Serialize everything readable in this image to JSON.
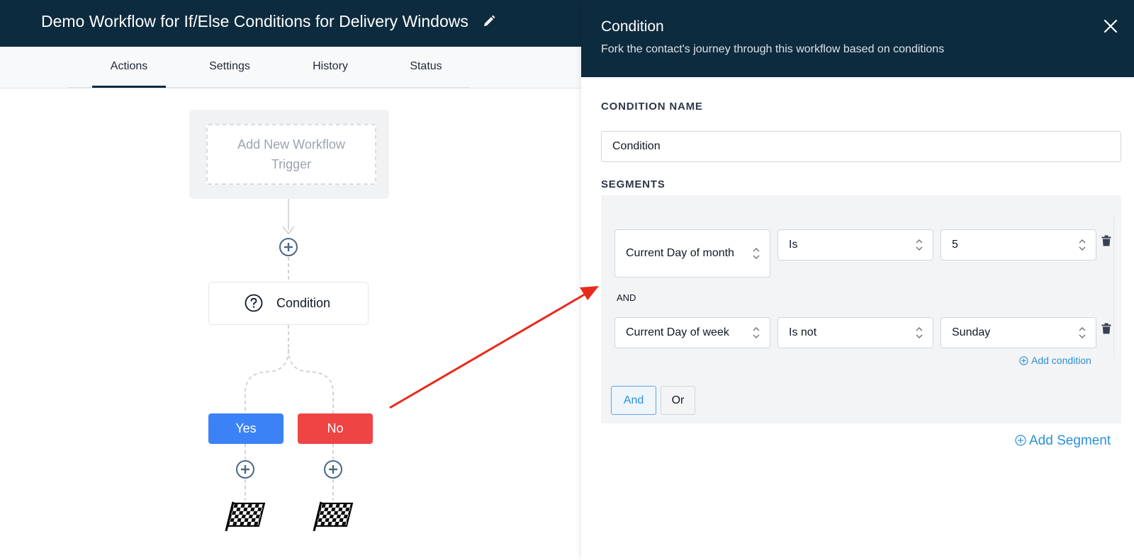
{
  "header": {
    "title": "Demo Workflow for If/Else Conditions for Delivery Windows"
  },
  "tabs": [
    {
      "label": "Actions",
      "active": true
    },
    {
      "label": "Settings",
      "active": false
    },
    {
      "label": "History",
      "active": false
    },
    {
      "label": "Status",
      "active": false
    }
  ],
  "canvas": {
    "trigger_label": "Add New Workflow Trigger",
    "condition_label": "Condition",
    "yes_label": "Yes",
    "no_label": "No"
  },
  "panel": {
    "title": "Condition",
    "subtitle": "Fork the contact's journey through this workflow based on conditions",
    "condition_name_label": "CONDITION NAME",
    "condition_name_value": "Condition",
    "segments_label": "SEGMENTS",
    "conditions": [
      {
        "field": "Current Day of month",
        "operator": "Is",
        "value": "5"
      },
      {
        "field": "Current Day of week",
        "operator": "Is not",
        "value": "Sunday"
      }
    ],
    "joiner_label": "AND",
    "add_condition_label": "Add condition",
    "and_button": "And",
    "or_button": "Or",
    "add_segment_label": "Add Segment"
  },
  "colors": {
    "header_bg": "#0d2b3e",
    "yes": "#3b82f6",
    "no": "#ef4444",
    "link": "#2b8fd6",
    "annotation_arrow": "#e8291c"
  }
}
